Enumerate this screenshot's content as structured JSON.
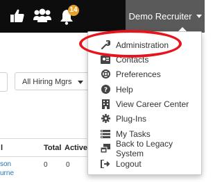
{
  "topbar": {
    "notification_count": "14",
    "user_name": "Demo Recruiter",
    "icons": [
      "thumbs-up-icon",
      "users-icon",
      "bell-icon"
    ]
  },
  "filters": {
    "hiring_managers_selected": "All Hiring Mgrs"
  },
  "table": {
    "columns": [
      "l",
      "Total",
      "Active"
    ],
    "row": {
      "name_line1": "son",
      "name_line2": "urne",
      "total": "0",
      "active": "0"
    }
  },
  "user_dropdown": {
    "items": [
      {
        "label": "Administration",
        "icon": "wrench-icon"
      },
      {
        "label": "Contacts",
        "icon": "contacts-icon"
      },
      {
        "label": "Preferences",
        "icon": "life-ring-icon"
      },
      {
        "label": "Help",
        "icon": "help-icon"
      },
      {
        "label": "View Career Center",
        "icon": "building-icon"
      },
      {
        "label": "Plug-Ins",
        "icon": "cog-icon"
      },
      {
        "label": "My Tasks",
        "icon": "tasks-icon"
      },
      {
        "label": "Back to Legacy System",
        "icon": "window-restore-icon"
      },
      {
        "label": "Logout",
        "icon": "logout-icon"
      }
    ]
  },
  "colors": {
    "topbar_bg": "#0d0d0d",
    "user_menu_bg": "#5a5a5a",
    "badge": "#e79f2c",
    "highlight_oval": "#e8141b"
  }
}
